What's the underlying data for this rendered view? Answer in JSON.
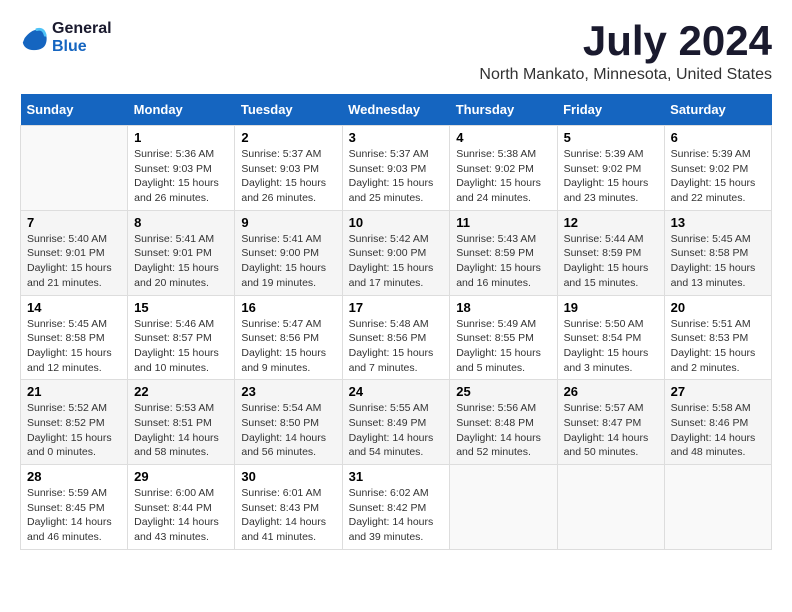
{
  "logo": {
    "line1": "General",
    "line2": "Blue"
  },
  "title": "July 2024",
  "subtitle": "North Mankato, Minnesota, United States",
  "headers": [
    "Sunday",
    "Monday",
    "Tuesday",
    "Wednesday",
    "Thursday",
    "Friday",
    "Saturday"
  ],
  "weeks": [
    [
      {
        "day": "",
        "info": ""
      },
      {
        "day": "1",
        "info": "Sunrise: 5:36 AM\nSunset: 9:03 PM\nDaylight: 15 hours\nand 26 minutes."
      },
      {
        "day": "2",
        "info": "Sunrise: 5:37 AM\nSunset: 9:03 PM\nDaylight: 15 hours\nand 26 minutes."
      },
      {
        "day": "3",
        "info": "Sunrise: 5:37 AM\nSunset: 9:03 PM\nDaylight: 15 hours\nand 25 minutes."
      },
      {
        "day": "4",
        "info": "Sunrise: 5:38 AM\nSunset: 9:02 PM\nDaylight: 15 hours\nand 24 minutes."
      },
      {
        "day": "5",
        "info": "Sunrise: 5:39 AM\nSunset: 9:02 PM\nDaylight: 15 hours\nand 23 minutes."
      },
      {
        "day": "6",
        "info": "Sunrise: 5:39 AM\nSunset: 9:02 PM\nDaylight: 15 hours\nand 22 minutes."
      }
    ],
    [
      {
        "day": "7",
        "info": "Sunrise: 5:40 AM\nSunset: 9:01 PM\nDaylight: 15 hours\nand 21 minutes."
      },
      {
        "day": "8",
        "info": "Sunrise: 5:41 AM\nSunset: 9:01 PM\nDaylight: 15 hours\nand 20 minutes."
      },
      {
        "day": "9",
        "info": "Sunrise: 5:41 AM\nSunset: 9:00 PM\nDaylight: 15 hours\nand 19 minutes."
      },
      {
        "day": "10",
        "info": "Sunrise: 5:42 AM\nSunset: 9:00 PM\nDaylight: 15 hours\nand 17 minutes."
      },
      {
        "day": "11",
        "info": "Sunrise: 5:43 AM\nSunset: 8:59 PM\nDaylight: 15 hours\nand 16 minutes."
      },
      {
        "day": "12",
        "info": "Sunrise: 5:44 AM\nSunset: 8:59 PM\nDaylight: 15 hours\nand 15 minutes."
      },
      {
        "day": "13",
        "info": "Sunrise: 5:45 AM\nSunset: 8:58 PM\nDaylight: 15 hours\nand 13 minutes."
      }
    ],
    [
      {
        "day": "14",
        "info": "Sunrise: 5:45 AM\nSunset: 8:58 PM\nDaylight: 15 hours\nand 12 minutes."
      },
      {
        "day": "15",
        "info": "Sunrise: 5:46 AM\nSunset: 8:57 PM\nDaylight: 15 hours\nand 10 minutes."
      },
      {
        "day": "16",
        "info": "Sunrise: 5:47 AM\nSunset: 8:56 PM\nDaylight: 15 hours\nand 9 minutes."
      },
      {
        "day": "17",
        "info": "Sunrise: 5:48 AM\nSunset: 8:56 PM\nDaylight: 15 hours\nand 7 minutes."
      },
      {
        "day": "18",
        "info": "Sunrise: 5:49 AM\nSunset: 8:55 PM\nDaylight: 15 hours\nand 5 minutes."
      },
      {
        "day": "19",
        "info": "Sunrise: 5:50 AM\nSunset: 8:54 PM\nDaylight: 15 hours\nand 3 minutes."
      },
      {
        "day": "20",
        "info": "Sunrise: 5:51 AM\nSunset: 8:53 PM\nDaylight: 15 hours\nand 2 minutes."
      }
    ],
    [
      {
        "day": "21",
        "info": "Sunrise: 5:52 AM\nSunset: 8:52 PM\nDaylight: 15 hours\nand 0 minutes."
      },
      {
        "day": "22",
        "info": "Sunrise: 5:53 AM\nSunset: 8:51 PM\nDaylight: 14 hours\nand 58 minutes."
      },
      {
        "day": "23",
        "info": "Sunrise: 5:54 AM\nSunset: 8:50 PM\nDaylight: 14 hours\nand 56 minutes."
      },
      {
        "day": "24",
        "info": "Sunrise: 5:55 AM\nSunset: 8:49 PM\nDaylight: 14 hours\nand 54 minutes."
      },
      {
        "day": "25",
        "info": "Sunrise: 5:56 AM\nSunset: 8:48 PM\nDaylight: 14 hours\nand 52 minutes."
      },
      {
        "day": "26",
        "info": "Sunrise: 5:57 AM\nSunset: 8:47 PM\nDaylight: 14 hours\nand 50 minutes."
      },
      {
        "day": "27",
        "info": "Sunrise: 5:58 AM\nSunset: 8:46 PM\nDaylight: 14 hours\nand 48 minutes."
      }
    ],
    [
      {
        "day": "28",
        "info": "Sunrise: 5:59 AM\nSunset: 8:45 PM\nDaylight: 14 hours\nand 46 minutes."
      },
      {
        "day": "29",
        "info": "Sunrise: 6:00 AM\nSunset: 8:44 PM\nDaylight: 14 hours\nand 43 minutes."
      },
      {
        "day": "30",
        "info": "Sunrise: 6:01 AM\nSunset: 8:43 PM\nDaylight: 14 hours\nand 41 minutes."
      },
      {
        "day": "31",
        "info": "Sunrise: 6:02 AM\nSunset: 8:42 PM\nDaylight: 14 hours\nand 39 minutes."
      },
      {
        "day": "",
        "info": ""
      },
      {
        "day": "",
        "info": ""
      },
      {
        "day": "",
        "info": ""
      }
    ]
  ]
}
